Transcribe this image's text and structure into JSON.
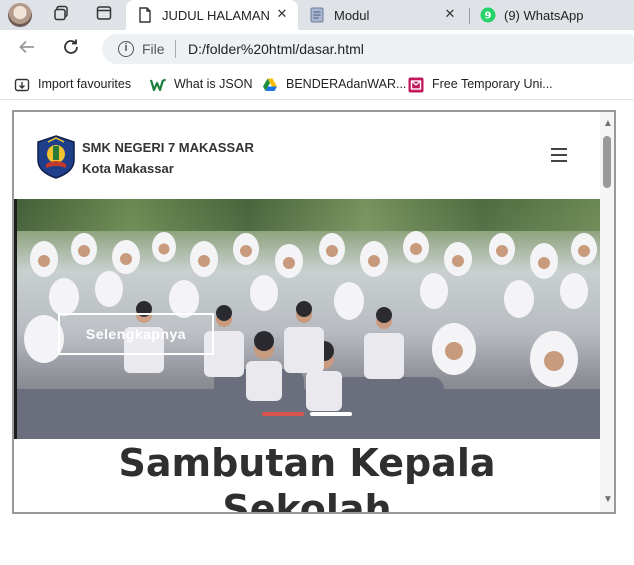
{
  "browser": {
    "tabs": [
      {
        "title": "JUDUL HALAMAN",
        "active": true,
        "icon": "page-icon"
      },
      {
        "title": "Modul",
        "active": false,
        "icon": "doc-icon"
      },
      {
        "title": "(9) WhatsApp",
        "active": false,
        "icon": "whatsapp-icon"
      }
    ],
    "address": {
      "scheme_label": "File",
      "url": "D:/folder%20html/dasar.html"
    },
    "bookmarks": [
      {
        "label": "Import favourites",
        "icon": "import-icon"
      },
      {
        "label": "What is JSON",
        "icon": "w-logo-icon"
      },
      {
        "label": "BENDERAdanWAR...",
        "icon": "drive-icon"
      },
      {
        "label": "Free Temporary Uni...",
        "icon": "temp-mail-icon"
      }
    ]
  },
  "page": {
    "school_name": "SMK NEGERI 7 MAKASSAR",
    "school_city": "Kota Makassar",
    "hero_button": "Selengkapnya",
    "hero_slide_count": 2,
    "hero_active_slide": 1,
    "section_title_line1": "Sambutan Kepala",
    "section_title_line2": "Sekolah"
  },
  "colors": {
    "tabstrip": "#dfe3e8",
    "active_dot": "#d9534f",
    "inactive_dot": "#ffffff",
    "title_text": "#2f2f2f"
  }
}
